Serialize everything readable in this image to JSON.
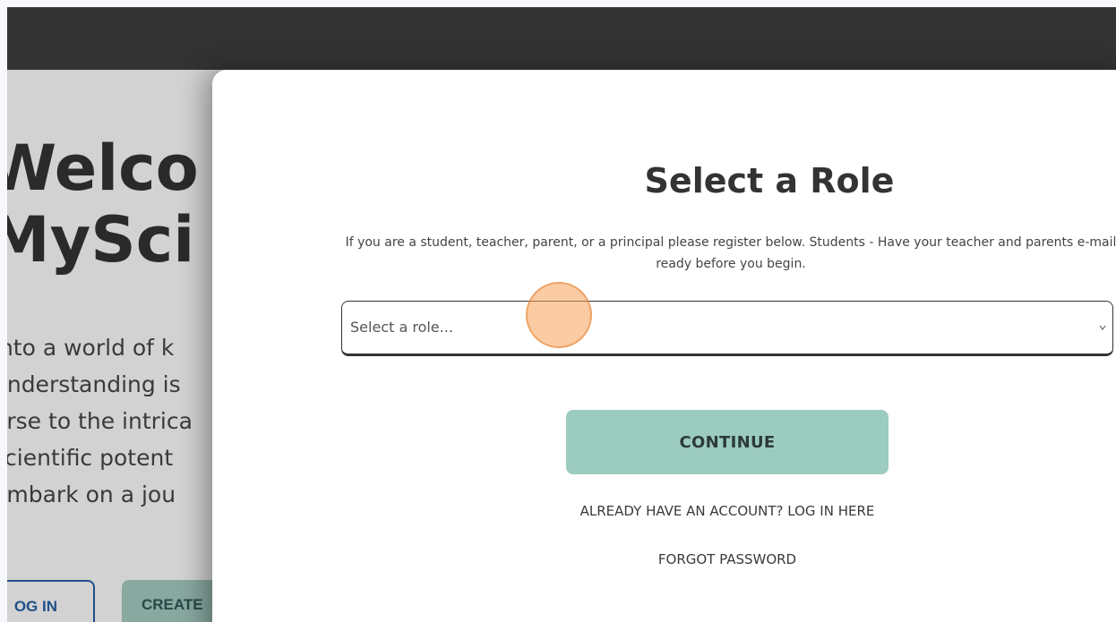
{
  "background": {
    "headline_lines": [
      "Welco",
      "MySci"
    ],
    "paragraph_lines": [
      "into a world of k",
      "understanding is",
      "erse to the intrica",
      "scientific potent",
      "embark on a jou"
    ],
    "login_button": "OG IN",
    "create_button": "CREATE"
  },
  "modal": {
    "title": "Select a Role",
    "description": "If you are a student, teacher, parent, or a principal please register below. Students - Have your teacher and parents e-mail ready before you begin.",
    "role_select": {
      "placeholder": "Select a role..."
    },
    "continue_button": "CONTINUE",
    "login_link": "ALREADY HAVE AN ACCOUNT? LOG IN HERE",
    "forgot_link": "FORGOT PASSWORD"
  },
  "colors": {
    "topbar": "#333333",
    "continue_button": "#9ccbbf",
    "cursor_highlight": "#f8a058"
  },
  "icons": {
    "select_chevron": "chevron-down-icon"
  }
}
